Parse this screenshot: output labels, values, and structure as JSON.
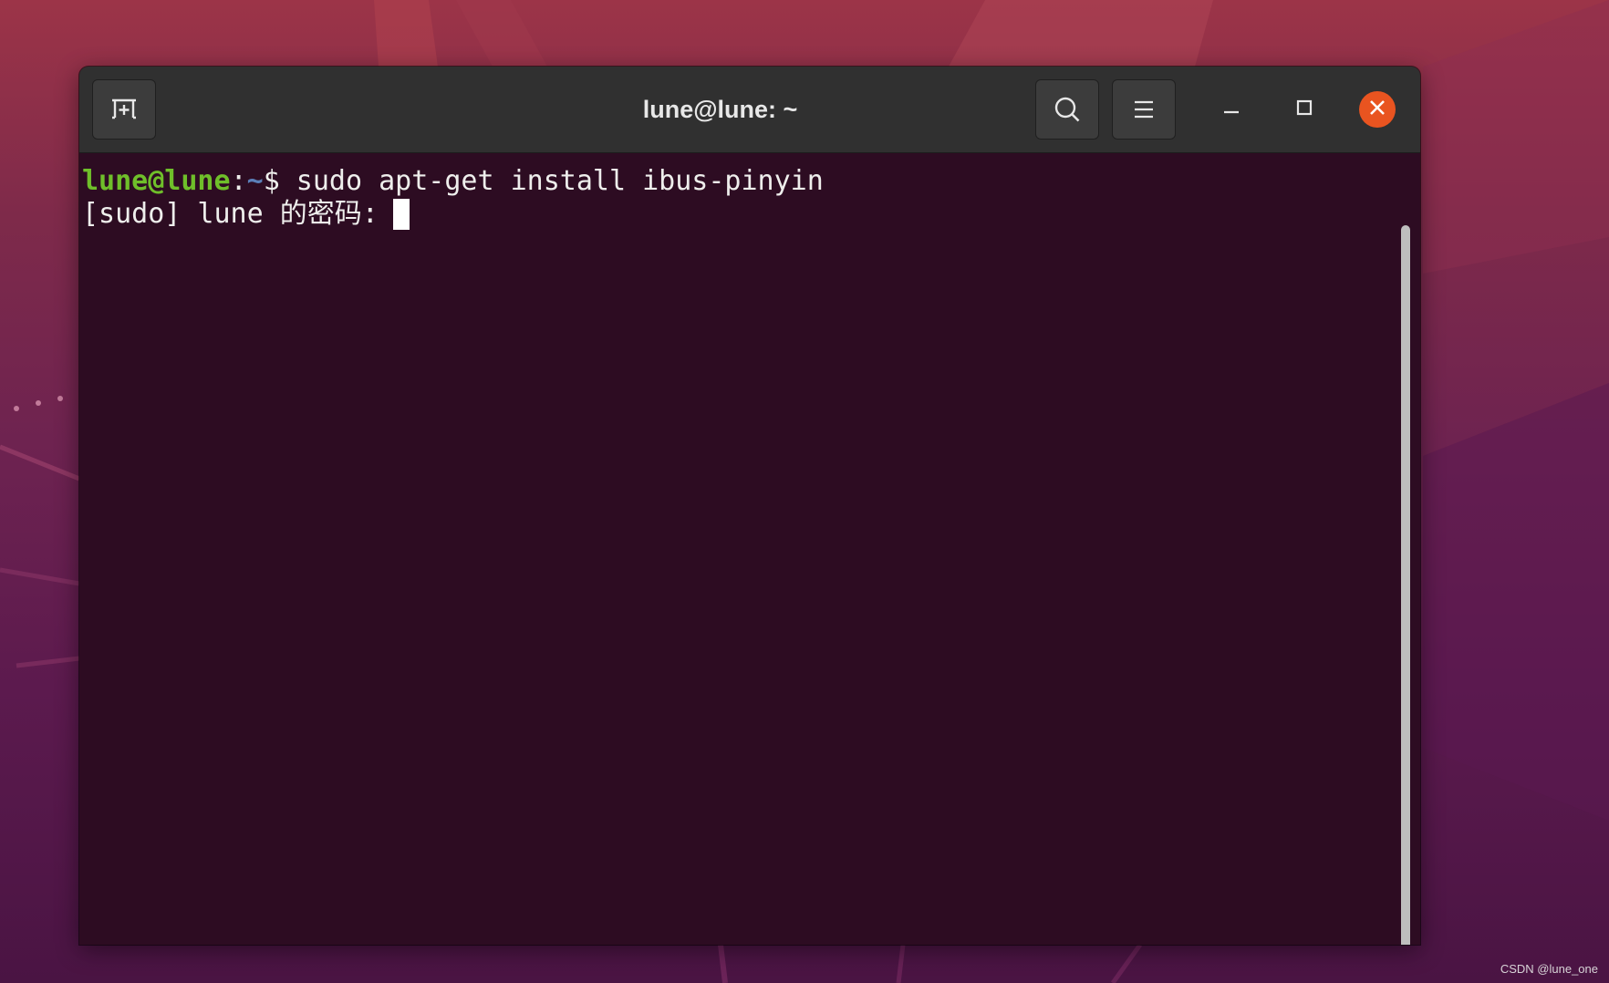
{
  "window": {
    "title": "lune@lune: ~"
  },
  "terminal": {
    "line1": {
      "user_host": "lune@lune",
      "colon": ":",
      "path": "~",
      "sign": "$",
      "command": " sudo apt-get install ibus-pinyin"
    },
    "line2": {
      "text": "[sudo] lune 的密码:"
    }
  },
  "icons": {
    "new_tab": "new-tab-icon",
    "search": "search-icon",
    "menu": "hamburger-menu-icon",
    "minimize": "minimize-icon",
    "maximize": "maximize-icon",
    "close": "close-icon"
  },
  "colors": {
    "terminal_background": "#2d0c22",
    "headerbar": "#303030",
    "prompt_user": "#6fbf2a",
    "prompt_path": "#5b7fb8",
    "close_button": "#e95420"
  },
  "watermark": "CSDN @lune_one"
}
